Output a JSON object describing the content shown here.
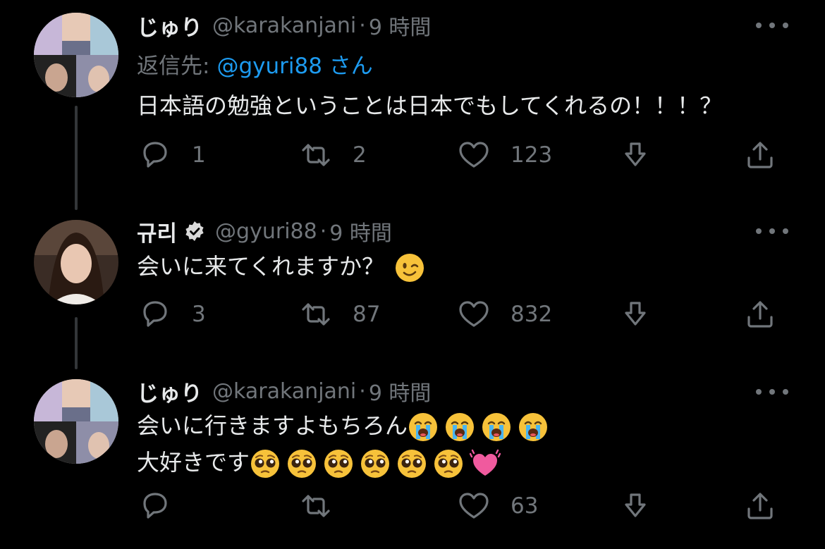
{
  "tweets": [
    {
      "name": "じゅり",
      "handle": "@karakanjani",
      "dot": "·",
      "time": "9 時間",
      "reply_prefix": "返信先:",
      "reply_mention": "@gyuri88",
      "reply_suffix": "さん",
      "text": "日本語の勉強ということは日本でもしてくれるの！！！？",
      "replies": "1",
      "retweets": "2",
      "likes": "123"
    },
    {
      "name": "규리",
      "handle": "@gyuri88",
      "dot": "·",
      "time": "9 時間",
      "verified": true,
      "text": "会いに来てくれますか？",
      "emoji": [
        "winking-face"
      ],
      "replies": "3",
      "retweets": "87",
      "likes": "832"
    },
    {
      "name": "じゅり",
      "handle": "@karakanjani",
      "dot": "·",
      "time": "9 時間",
      "text_line1": "会いに行きますよもちろん",
      "text_line1_emoji": [
        "loudly-crying-face",
        "loudly-crying-face",
        "loudly-crying-face",
        "loudly-crying-face"
      ],
      "text_line2": "大好きです",
      "text_line2_emoji": [
        "pleading-face",
        "pleading-face",
        "pleading-face",
        "pleading-face",
        "pleading-face",
        "pleading-face",
        "growing-heart"
      ],
      "likes": "63"
    }
  ],
  "colors": {
    "background": "#000000",
    "primary_text": "#e7e9ea",
    "secondary_text": "#71767b",
    "link": "#1d9bf0",
    "verified": "#d9d9d9"
  }
}
